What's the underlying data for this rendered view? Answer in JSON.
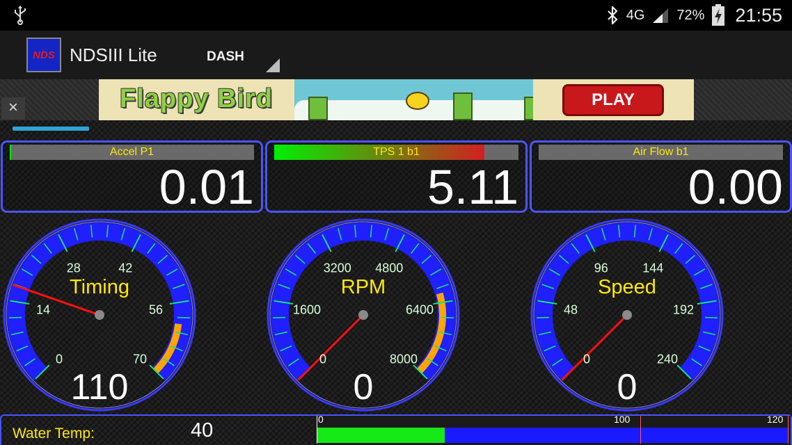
{
  "statusbar": {
    "network": "4G",
    "battery": "72%",
    "time": "21:55"
  },
  "actionbar": {
    "app_logo_text": "NDS",
    "app_title": "NDSIII Lite",
    "screen_selector": "DASH"
  },
  "ad": {
    "close_label": "×",
    "game_title": "Flappy Bird",
    "play_label": "PLAY"
  },
  "panels": [
    {
      "label": "Accel P1",
      "value": "0.01",
      "bar_fraction": 0.002
    },
    {
      "label": "TPS 1 b1",
      "value": "5.11",
      "bar_fraction": 0.86
    },
    {
      "label": "Air Flow b1",
      "value": "0.00",
      "bar_fraction": 0.0
    }
  ],
  "gauges": [
    {
      "title": "Timing",
      "value": "110",
      "ticks": [
        "0",
        "14",
        "28",
        "42",
        "56",
        "70"
      ],
      "min": 0,
      "max": 70,
      "needle": 110,
      "warn_start": 60
    },
    {
      "title": "RPM",
      "value": "0",
      "ticks": [
        "0",
        "1600",
        "3200",
        "4800",
        "6400",
        "8000"
      ],
      "min": 0,
      "max": 8000,
      "needle": 0,
      "warn_start": 6200
    },
    {
      "title": "Speed",
      "value": "0",
      "ticks": [
        "0",
        "48",
        "96",
        "144",
        "192",
        "240"
      ],
      "min": 0,
      "max": 240,
      "needle": 0,
      "warn_start": null
    }
  ],
  "water_temp": {
    "label": "Water Temp:",
    "value": "40",
    "scale_min": "0",
    "scale_mid": "100",
    "scale_max": "120",
    "min": 0,
    "max": 120,
    "warn": 100
  },
  "colors": {
    "accent_blue": "#2f39ff",
    "needle": "#ff1010",
    "warn_arc": "#ffa500",
    "label_yellow": "#ffea00",
    "bar_green": "#17e817"
  }
}
